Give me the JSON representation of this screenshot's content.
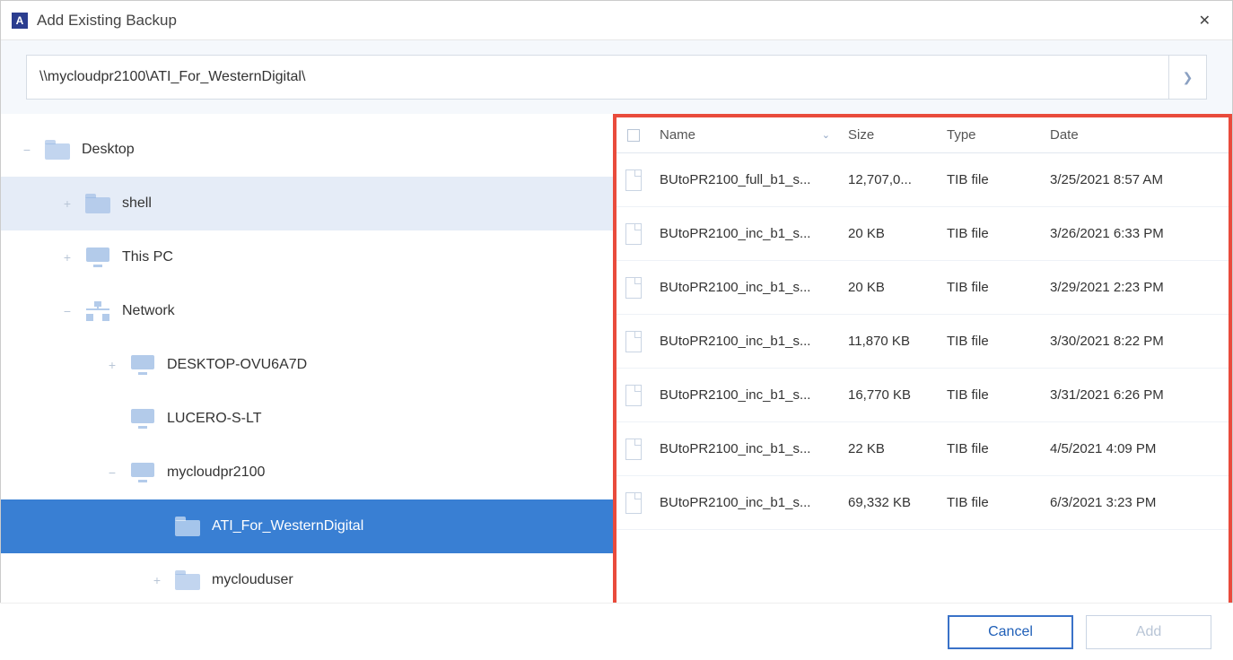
{
  "window": {
    "title": "Add Existing Backup"
  },
  "path": {
    "value": "\\\\mycloudpr2100\\ATI_For_WesternDigital\\"
  },
  "tree": {
    "desktop": "Desktop",
    "shell": "shell",
    "thispc": "This PC",
    "network": "Network",
    "desktop_ovu": "DESKTOP-OVU6A7D",
    "lucero": "LUCERO-S-LT",
    "mycloud": "mycloudpr2100",
    "ati": "ATI_For_WesternDigital",
    "myclouduser": "myclouduser"
  },
  "columns": {
    "name": "Name",
    "size": "Size",
    "type": "Type",
    "date": "Date"
  },
  "files": [
    {
      "name": "BUtoPR2100_full_b1_s...",
      "size": "12,707,0...",
      "type": "TIB file",
      "date": "3/25/2021 8:57 AM"
    },
    {
      "name": "BUtoPR2100_inc_b1_s...",
      "size": "20 KB",
      "type": "TIB file",
      "date": "3/26/2021 6:33 PM"
    },
    {
      "name": "BUtoPR2100_inc_b1_s...",
      "size": "20 KB",
      "type": "TIB file",
      "date": "3/29/2021 2:23 PM"
    },
    {
      "name": "BUtoPR2100_inc_b1_s...",
      "size": "11,870 KB",
      "type": "TIB file",
      "date": "3/30/2021 8:22 PM"
    },
    {
      "name": "BUtoPR2100_inc_b1_s...",
      "size": "16,770 KB",
      "type": "TIB file",
      "date": "3/31/2021 6:26 PM"
    },
    {
      "name": "BUtoPR2100_inc_b1_s...",
      "size": "22 KB",
      "type": "TIB file",
      "date": "4/5/2021 4:09 PM"
    },
    {
      "name": "BUtoPR2100_inc_b1_s...",
      "size": "69,332 KB",
      "type": "TIB file",
      "date": "6/3/2021 3:23 PM"
    }
  ],
  "buttons": {
    "cancel": "Cancel",
    "add": "Add"
  }
}
